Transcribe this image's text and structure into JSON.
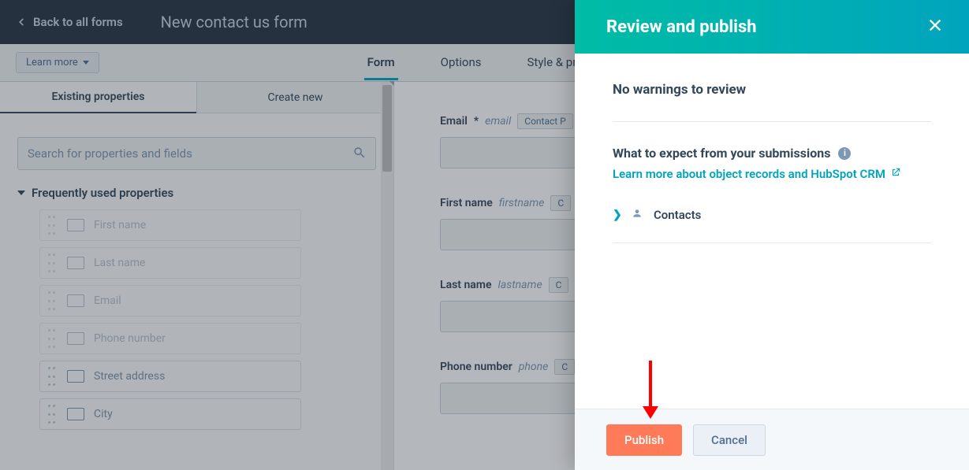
{
  "header": {
    "back_label": "Back to all forms",
    "title": "New contact us form"
  },
  "learn_more": "Learn more",
  "tabs": {
    "form": "Form",
    "options": "Options",
    "style": "Style & preview"
  },
  "sidebar": {
    "tab_existing": "Existing properties",
    "tab_create": "Create new",
    "search_placeholder": "Search for properties and fields",
    "freq_header": "Frequently used properties",
    "props": [
      "First name",
      "Last name",
      "Email",
      "Phone number",
      "Street address",
      "City"
    ]
  },
  "preview": {
    "fields": [
      {
        "label": "Email",
        "required": "*",
        "internal": "email",
        "chip": "Contact P"
      },
      {
        "label": "First name",
        "required": "",
        "internal": "firstname",
        "chip": "C"
      },
      {
        "label": "Last name",
        "required": "",
        "internal": "lastname",
        "chip": "C"
      },
      {
        "label": "Phone number",
        "required": "",
        "internal": "phone",
        "chip": "C"
      }
    ]
  },
  "panel": {
    "title": "Review and publish",
    "no_warnings": "No warnings to review",
    "expect": "What to expect from your submissions",
    "learn_link": "Learn more about object records and HubSpot CRM",
    "object": "Contacts",
    "publish": "Publish",
    "cancel": "Cancel"
  }
}
